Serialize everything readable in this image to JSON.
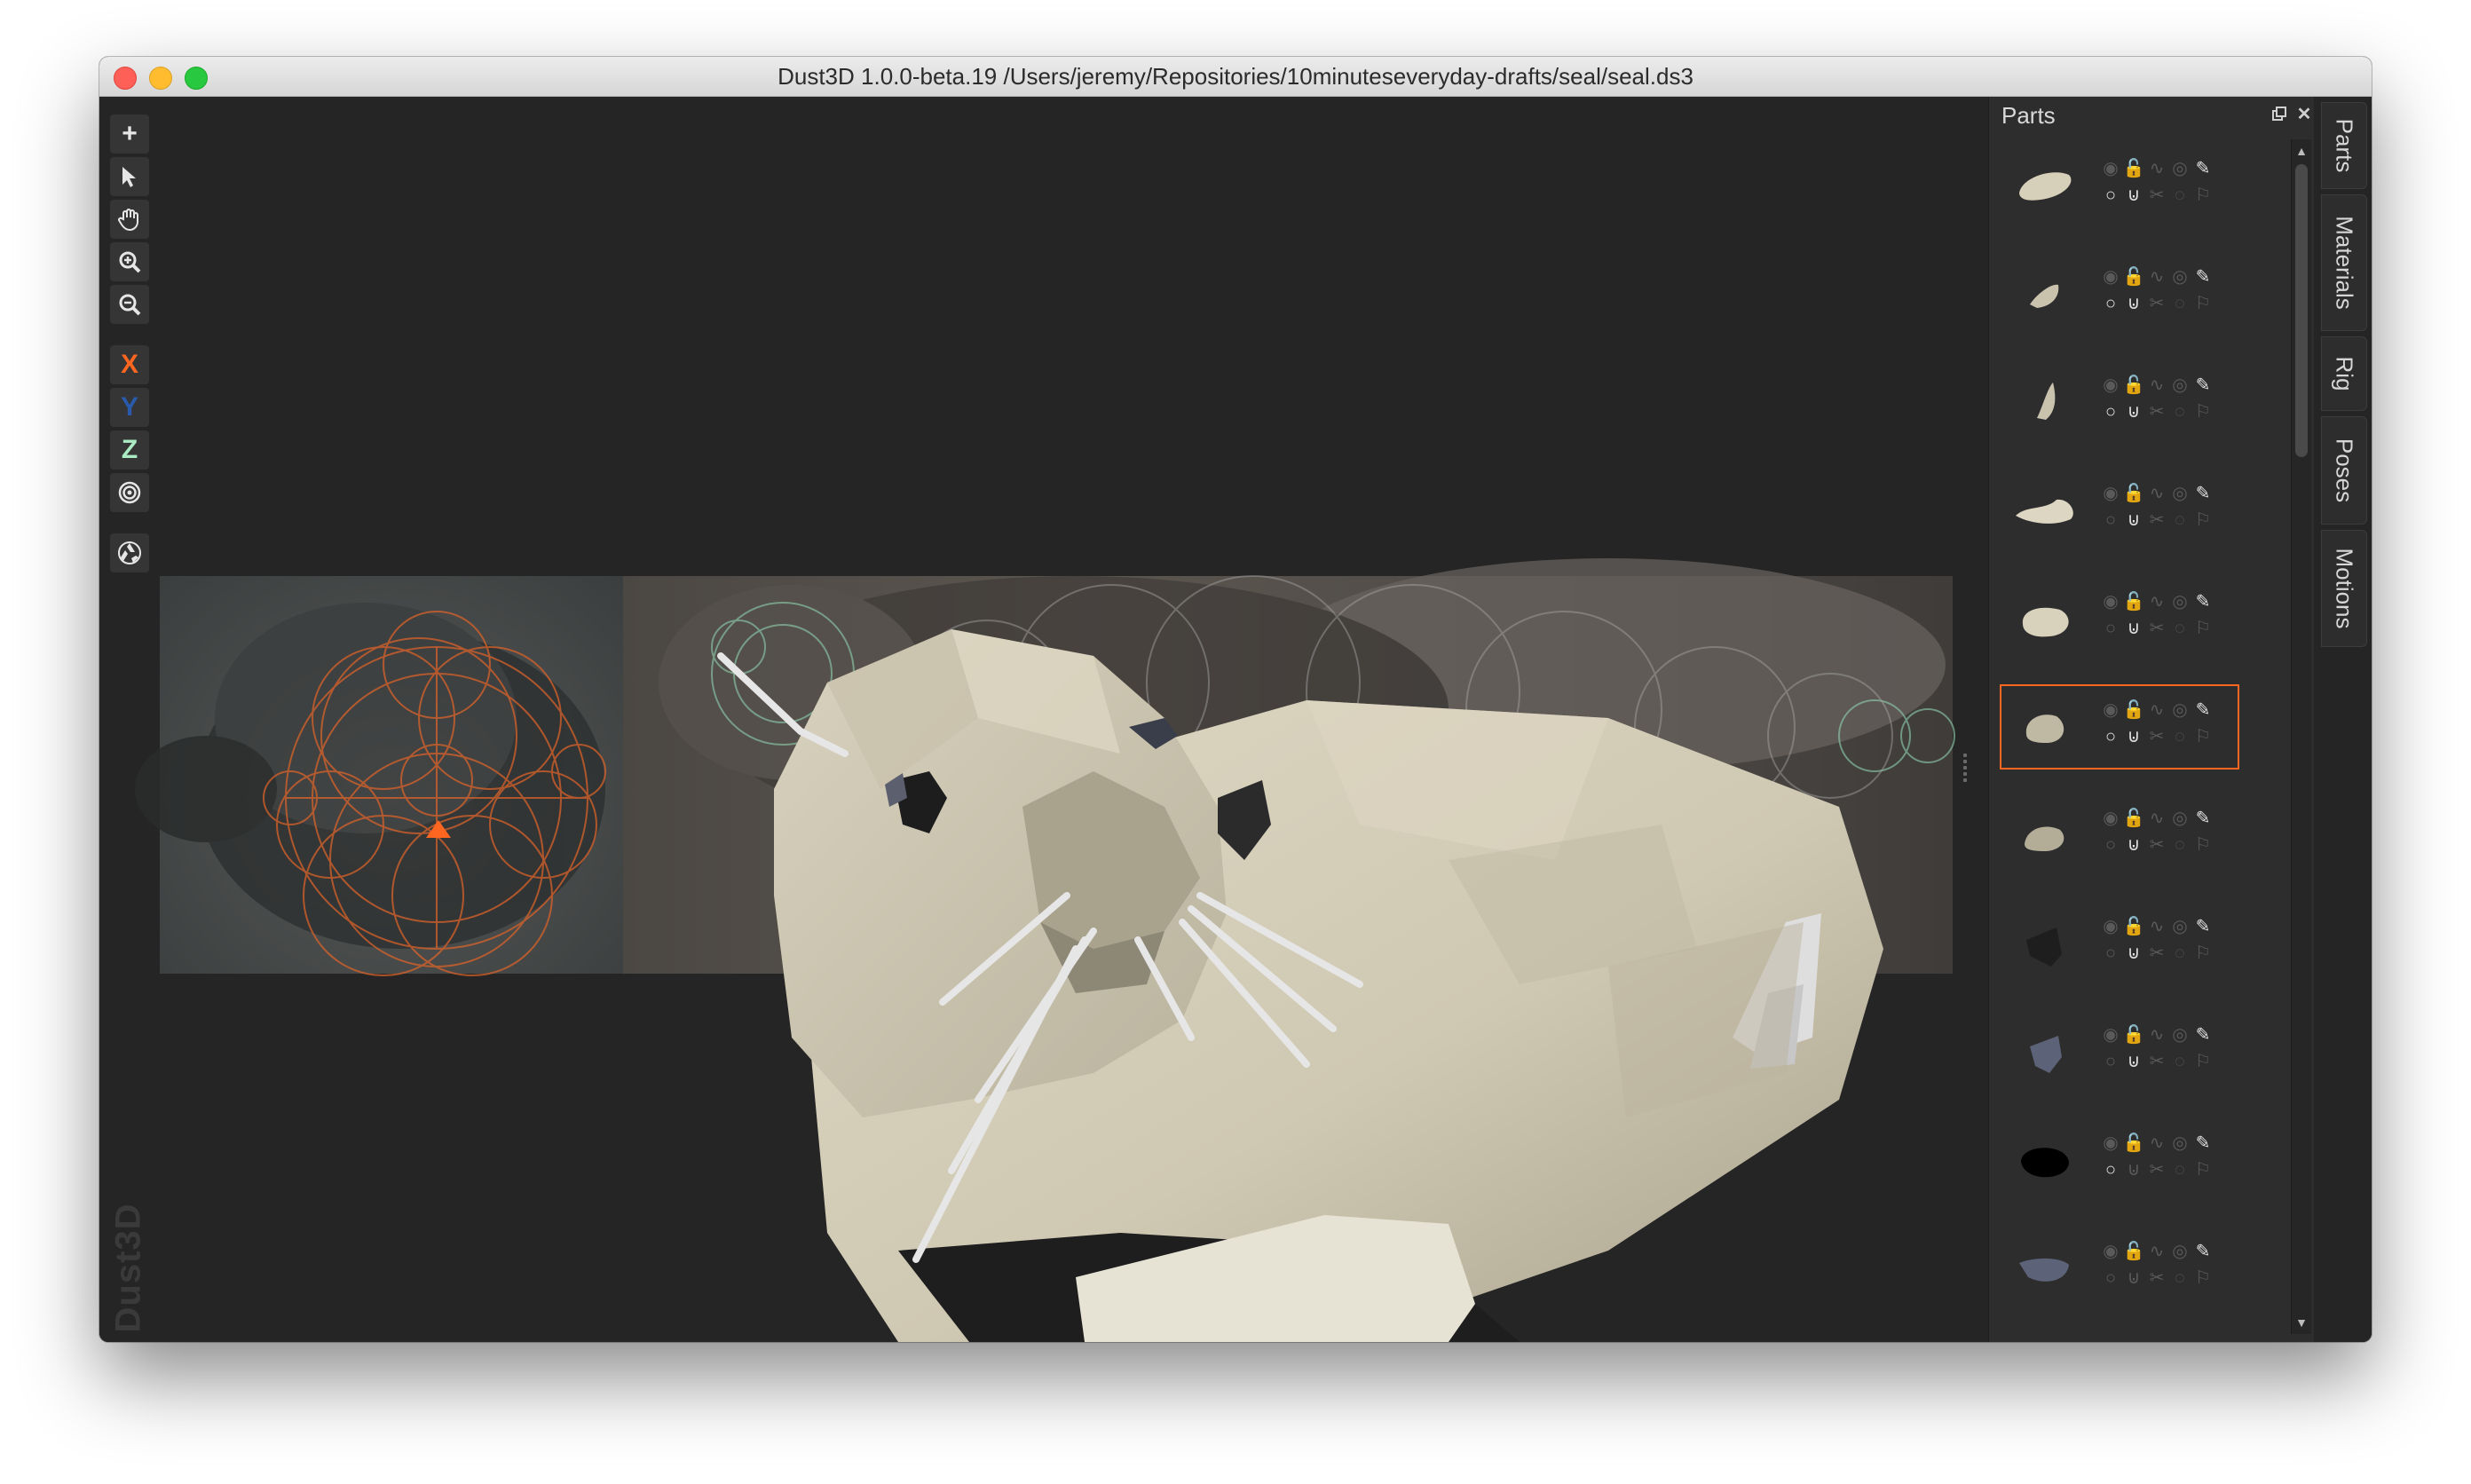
{
  "window": {
    "title": "Dust3D 1.0.0-beta.19 /Users/jeremy/Repositories/10minuteseveryday-drafts/seal/seal.ds3"
  },
  "toolbar": {
    "add_icon": "plus-icon",
    "select_icon": "pointer-icon",
    "drag_icon": "hand-icon",
    "zoom_in_icon": "zoom-in-icon",
    "zoom_out_icon": "zoom-out-icon",
    "x_label": "X",
    "y_label": "Y",
    "z_label": "Z",
    "radius_icon": "target-icon",
    "regenerate_icon": "recycle-icon",
    "colors": {
      "x": "#fc6621",
      "y": "#2a5aac",
      "z": "#aaebc4"
    }
  },
  "branding": {
    "watermark": "Dust3D"
  },
  "parts_panel": {
    "title": "Parts",
    "float_icon": "float-window-icon",
    "close_icon": "close-icon",
    "selected_index": 5,
    "selection_color": "#fc6621",
    "row_icons": [
      "eye-icon",
      "lock-icon",
      "link-icon",
      "deform-icon",
      "color-picker-icon",
      "subdivide-icon",
      "symmetry-icon",
      "cut-icon",
      "round-end-icon",
      "wrap-icon"
    ]
  },
  "side_tabs": {
    "parts": "Parts",
    "materials": "Materials",
    "rig": "Rig",
    "poses": "Poses",
    "motions": "Motions"
  },
  "model": {
    "color": "#d6cfba"
  }
}
